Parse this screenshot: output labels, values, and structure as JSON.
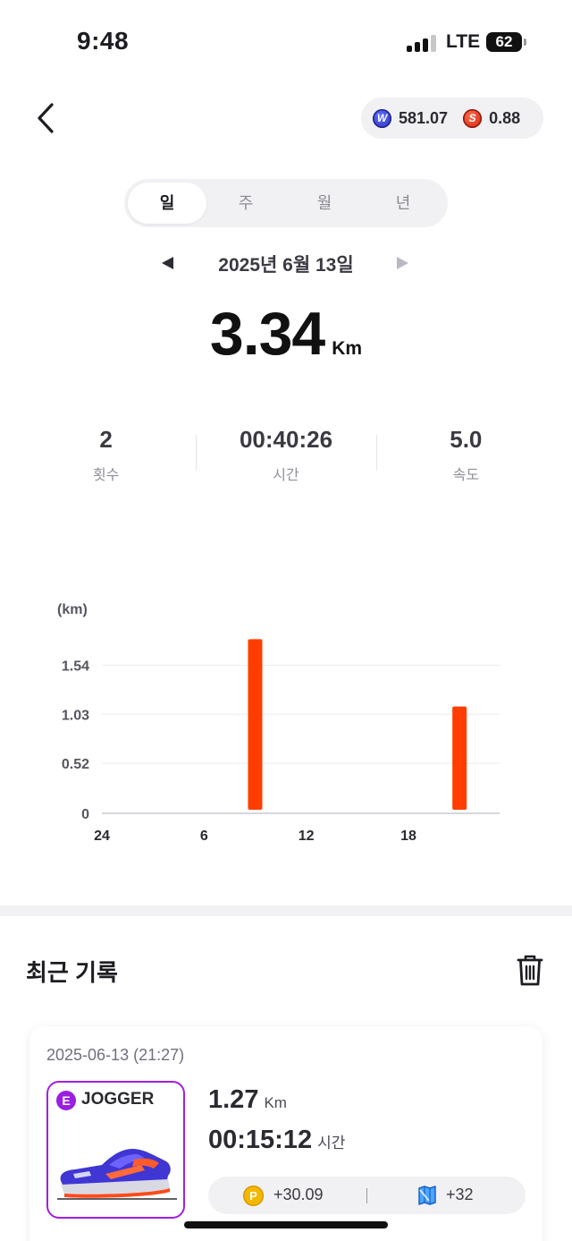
{
  "status_bar": {
    "time": "9:48",
    "network": "LTE",
    "battery": "62"
  },
  "balances": {
    "w_value": "581.07",
    "s_value": "0.88",
    "w_coin": "W",
    "s_coin": "S"
  },
  "period_tabs": [
    {
      "label": "일",
      "active": true
    },
    {
      "label": "주",
      "active": false
    },
    {
      "label": "월",
      "active": false
    },
    {
      "label": "년",
      "active": false
    }
  ],
  "date": {
    "label": "2025년 6월 13일"
  },
  "total": {
    "value": "3.34",
    "unit": "Km"
  },
  "stats": [
    {
      "value": "2",
      "label": "횟수"
    },
    {
      "value": "00:40:26",
      "label": "시간"
    },
    {
      "value": "5.0",
      "label": "속도"
    }
  ],
  "chart_data": {
    "type": "bar",
    "unit_label": "(km)",
    "y_ticks": [
      0,
      0.52,
      1.03,
      1.54
    ],
    "y_tick_labels": [
      "0",
      "0.52",
      "1.03",
      "1.54"
    ],
    "ylim": [
      0,
      1.85
    ],
    "x_ticks": [
      0,
      6,
      12,
      18
    ],
    "x_tick_labels": [
      "24",
      "6",
      "12",
      "18"
    ],
    "xlim": [
      -0.5,
      23.5
    ],
    "grid": true,
    "bar_color": "#ff3d00",
    "bars": [
      {
        "hour": 9,
        "value": 1.81
      },
      {
        "hour": 21,
        "value": 1.11
      }
    ]
  },
  "recent": {
    "title": "최근 기록",
    "records": [
      {
        "date": "2025-06-13 (21:27)",
        "grade": "E",
        "shoe_name": "JOGGER",
        "distance": "1.27",
        "distance_unit": "Km",
        "time": "00:15:12",
        "time_unit": "시간",
        "point_coin": "P",
        "points": "+30.09",
        "map_reward": "+32"
      }
    ]
  },
  "colors": {
    "accent_bar": "#ff3d00",
    "grade_purple": "#9b1fe0",
    "point_gold": "#f5b800"
  },
  "icons": [
    "back-chevron-icon",
    "w-coin-icon",
    "s-coin-icon",
    "trash-icon",
    "p-coin-icon",
    "map-icon"
  ]
}
